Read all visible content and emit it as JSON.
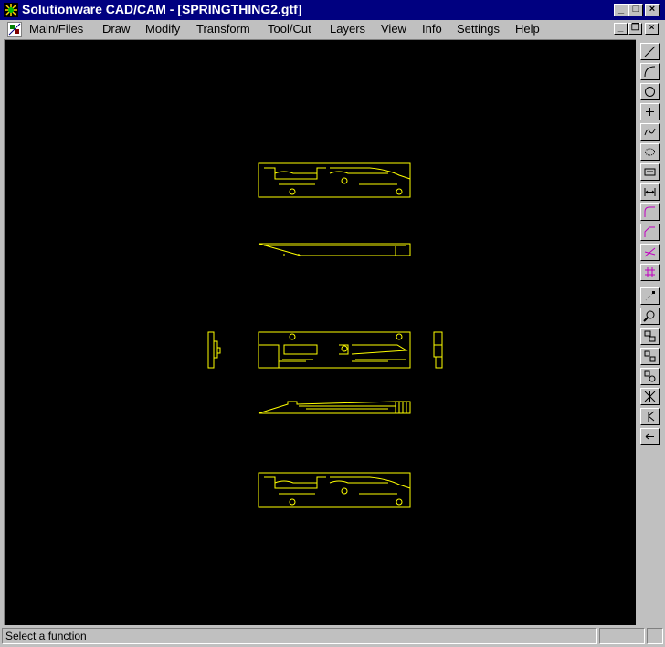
{
  "window": {
    "title": "Solutionware CAD/CAM - [SPRINGTHING2.gtf]",
    "minimize_glyph": "_",
    "maximize_glyph": "□",
    "close_glyph": "×"
  },
  "menu": {
    "items": [
      "Main/Files",
      "Draw",
      "Modify",
      "Transform",
      "Tool/Cut",
      "Layers",
      "View",
      "Info",
      "Settings",
      "Help"
    ]
  },
  "mdi": {
    "minimize_glyph": "_",
    "restore_glyph": "❐",
    "close_glyph": "×"
  },
  "drawing": {
    "line_color": "#ffff00",
    "background": "#000000"
  },
  "toolbar": {
    "tools": [
      "line-tool-icon",
      "arc-tool-icon",
      "circle-tool-icon",
      "point-tool-icon",
      "spline-tool-icon",
      "ellipse-tool-icon",
      "text-tool-icon",
      "dimension-tool-icon",
      "fillet-tool-icon",
      "chamfer-tool-icon",
      "trim-tool-icon",
      "hatch-tool-icon",
      "snap-tool-icon",
      "zoom-tool-icon",
      "window-select-icon",
      "move-tool-icon",
      "copy-tool-icon",
      "mirror-tool-icon",
      "rotate-tool-icon",
      "undo-tool-icon"
    ]
  },
  "status": {
    "message": "Select a function"
  }
}
